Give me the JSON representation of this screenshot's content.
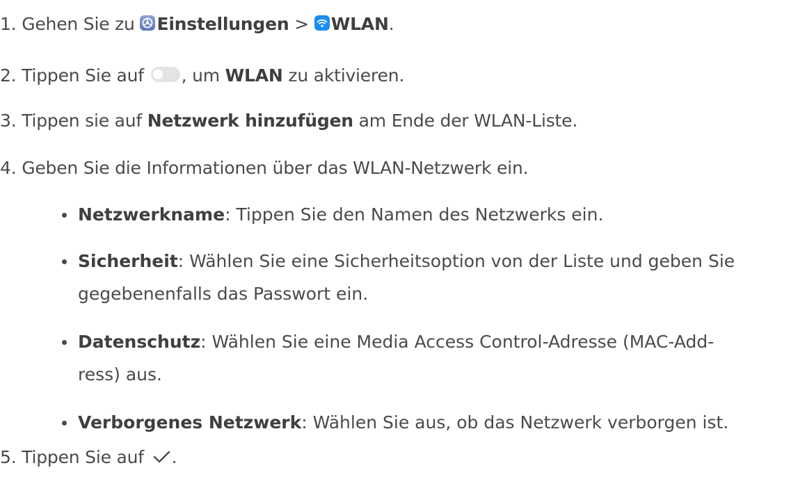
{
  "steps": [
    {
      "number": "1.",
      "text_a": "Gehen Sie zu ",
      "bold_a": "Einstellungen",
      "text_b": " > ",
      "bold_b": "WLAN",
      "text_c": "."
    },
    {
      "number": "2.",
      "text_a": "Tippen Sie auf ",
      "text_b": ", um ",
      "bold_a": "WLAN",
      "text_c": " zu aktivieren."
    },
    {
      "number": "3.",
      "text_a": "Tippen sie auf ",
      "bold_a": "Netzwerk hinzufügen",
      "text_b": " am Ende der WLAN-Liste."
    },
    {
      "number": "4.",
      "text_a": "Geben Sie die Informationen über das WLAN-Netzwerk ein."
    },
    {
      "number": "5.",
      "text_a": "Tippen Sie auf ",
      "text_b": "."
    }
  ],
  "bullets": [
    {
      "term": "Netzwerkname",
      "lines": [
        ": Tippen Sie den Namen des Netzwerks ein."
      ]
    },
    {
      "term": "Sicherheit",
      "lines": [
        ": Wählen Sie eine Sicherheitsoption von der Liste und geben Sie",
        "gegebenenfalls das Passwort ein."
      ]
    },
    {
      "term": "Datenschutz",
      "lines": [
        ": Wählen Sie eine Media Access Control-Adresse (MAC-Add-",
        "ress) aus."
      ]
    },
    {
      "term": "Verborgenes Netzwerk",
      "lines": [
        ": Wählen Sie aus, ob das Netzwerk verborgen ist."
      ]
    }
  ],
  "icons": {
    "settings": "settings-icon",
    "wifi": "wifi-icon",
    "toggle": "toggle-off-icon",
    "confirm": "checkmark-icon"
  }
}
